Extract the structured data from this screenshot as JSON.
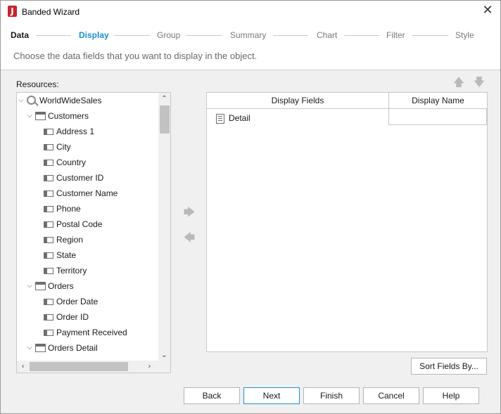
{
  "window": {
    "title": "Banded Wizard"
  },
  "steps": [
    "Data",
    "Display",
    "Group",
    "Summary",
    "Chart",
    "Filter",
    "Style"
  ],
  "instruction": "Choose the data fields that you want to display in the object.",
  "resources_label": "Resources:",
  "tree": {
    "root": "WorldWideSales",
    "customers": {
      "label": "Customers",
      "fields": [
        "Address 1",
        "City",
        "Country",
        "Customer ID",
        "Customer Name",
        "Phone",
        "Postal Code",
        "Region",
        "State",
        "Territory"
      ]
    },
    "orders": {
      "label": "Orders",
      "fields": [
        "Order Date",
        "Order ID",
        "Payment Received"
      ]
    },
    "orders_detail": {
      "label": "Orders Detail"
    }
  },
  "table": {
    "columns": [
      "Display Fields",
      "Display Name"
    ],
    "rows": [
      {
        "field": "Detail",
        "name": ""
      }
    ]
  },
  "buttons": {
    "sort": "Sort Fields By...",
    "back": "Back",
    "next": "Next",
    "finish": "Finish",
    "cancel": "Cancel",
    "help": "Help"
  },
  "icons": {
    "app": "J",
    "close": "✕",
    "move_up": "🡅",
    "move_down": "🡇",
    "add": "🡆",
    "remove": "🡄"
  }
}
